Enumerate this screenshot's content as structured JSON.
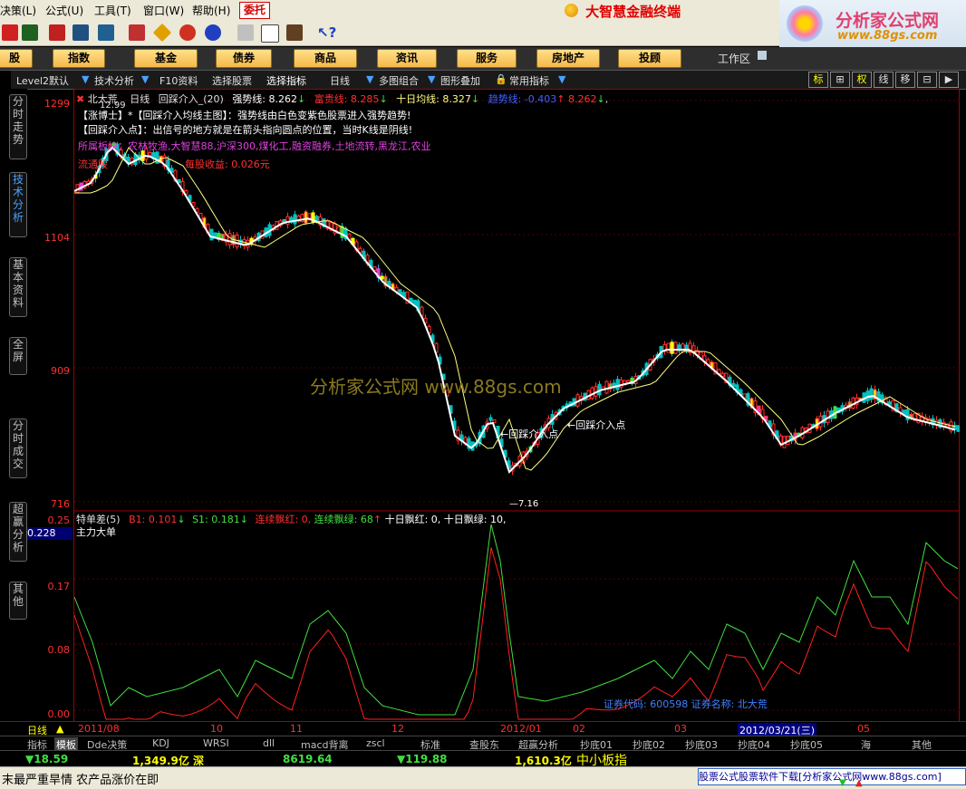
{
  "menubar": {
    "items": [
      "决策(L)",
      "公式(U)",
      "工具(T)",
      "窗口(W)",
      "帮助(H)"
    ],
    "delegate": "委托",
    "brand": "大智慧金融终端"
  },
  "site_logo": {
    "title": "分析家公式网",
    "url": "www.88gs.com"
  },
  "category_bar": {
    "buttons": [
      "股",
      "指数",
      "基金",
      "债券",
      "商品",
      "资讯",
      "服务",
      "房地产",
      "投顾"
    ],
    "workarea": "工作区"
  },
  "chart_toolbar": {
    "items": [
      "Level2默认",
      "技术分析",
      "F10资料",
      "选择股票",
      "选择指标",
      "日线",
      "多图组合",
      "图形叠加",
      "常用指标"
    ],
    "right_buttons": [
      "标",
      "⊞",
      "权",
      "线",
      "移",
      "⊟",
      "▶"
    ]
  },
  "left_tabs": [
    "分时走势",
    "技术分析",
    "基本资料",
    "全屏",
    "分时成交",
    "超赢分析",
    "其他"
  ],
  "price_axis": {
    "labels": [
      "1299",
      "1104",
      "909",
      "716"
    ],
    "lower_labels": [
      "0.25",
      "0.17",
      "0.08",
      "0.00"
    ],
    "current": "0.228"
  },
  "main_chart": {
    "stock": "北大荒",
    "period": "日线",
    "formula": "回踩介入_(20)",
    "strong_line": "强势线: 8.262",
    "wealth_line": "富贵线: 8.285",
    "ten_day": "十日均线: 8.327",
    "trend_line": "趋势线: -0.403",
    "trend_value": "8.262",
    "note1": "【涨博士】*【回踩介入均线主图】：强势线由白色变紫色股票进入强势趋势!",
    "note2": "【回踩介入点】：出信号的地方就是在箭头指向圆点的位置，当时K线是阴线!",
    "sectors": "所属板块：农林牧渔,大智慧88,沪深300,煤化工,融资融券,土地流转,黑龙江,农业",
    "circulation": "流通股",
    "eps": "每股收益: 0.026元",
    "watermark": "分析家公式网 www.88gs.com",
    "signal_label_1": "回踩介入点",
    "signal_label_2": "回踩介入点",
    "low_label": "7.16",
    "high_label": "12.99"
  },
  "sub_chart": {
    "name": "特单差(5)",
    "b1": "B1: 0.101",
    "s1": "S1: 0.181",
    "red_days": "连续飘红: 0,",
    "green_days": "连续飘绿: 68",
    "ten_red": "十日飘红: 0,",
    "ten_green": "十日飘绿: 10,",
    "subtitle": "主力大单",
    "stock_code": "证券代码: 600598 证券名称: 北大荒"
  },
  "date_axis": {
    "period": "日线",
    "labels": [
      "2011/08",
      "10",
      "11",
      "12",
      "2012/01",
      "02",
      "03",
      "2012/03/21(三)",
      "05"
    ]
  },
  "indicator_tabs": [
    "指标",
    "模板",
    "Dde决策",
    "KDJ",
    "WRSI",
    "dll",
    "macd背离",
    "zscl",
    "标准",
    "查股东",
    "超赢分析",
    "抄底01",
    "抄底02",
    "抄底03",
    "抄底04",
    "抄底05",
    "海",
    "其他"
  ],
  "quote_bar": {
    "items": [
      "▼18.59",
      "1,349.9亿 深",
      "8619.64",
      "▼119.88",
      "1,610.3亿",
      "中小板指"
    ]
  },
  "status_bar": {
    "news": "末最严重旱情 农产品涨价在即",
    "download": "股票公式股票软件下载[分析家公式网www.88gs.com]"
  },
  "colors": {
    "up": "#ff3030",
    "down": "#00c0c0",
    "axis": "#a00000",
    "strong_line": "#ffffff",
    "ma10": "#ffff80",
    "b1_line": "#ff2020",
    "s1_line": "#40e040"
  }
}
